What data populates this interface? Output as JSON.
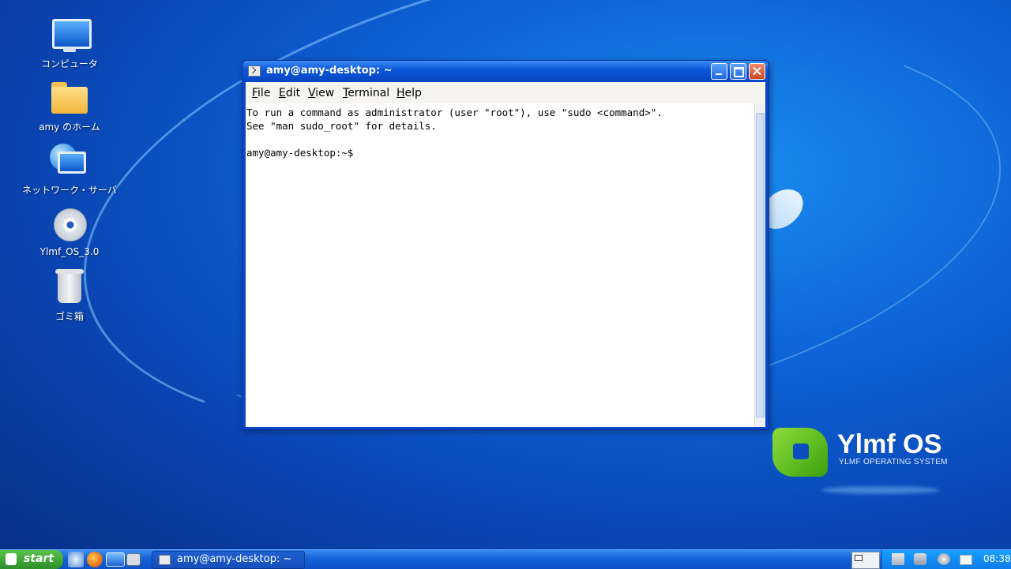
{
  "desktop": {
    "icons": [
      {
        "label": "コンピュータ",
        "icon": "computer-icon"
      },
      {
        "label": "amy のホーム",
        "icon": "home-folder-icon"
      },
      {
        "label": "ネットワーク・サーバ",
        "icon": "network-icon"
      },
      {
        "label": "Ylmf_OS_3.0",
        "icon": "cd-disc-icon"
      },
      {
        "label": "ゴミ箱",
        "icon": "trash-icon"
      }
    ]
  },
  "window": {
    "title": "amy@amy-desktop: ~",
    "menu": [
      "File",
      "Edit",
      "View",
      "Terminal",
      "Help"
    ],
    "terminal_lines": [
      "To run a command as administrator (user \"root\"), use \"sudo <command>\".",
      "See \"man sudo_root\" for details.",
      "",
      "amy@amy-desktop:~$"
    ]
  },
  "logo": {
    "title": "Ylmf OS",
    "subtitle": "YLMF OPERATING SYSTEM"
  },
  "taskbar": {
    "start_label": "start",
    "task_title": "amy@amy-desktop: ~",
    "clock": "08:38"
  },
  "colors": {
    "desktop_blue": "#0d63d6",
    "titlebar_blue": "#0a55d8",
    "start_green": "#2e8f2a",
    "tray_blue": "#0e7be8"
  }
}
